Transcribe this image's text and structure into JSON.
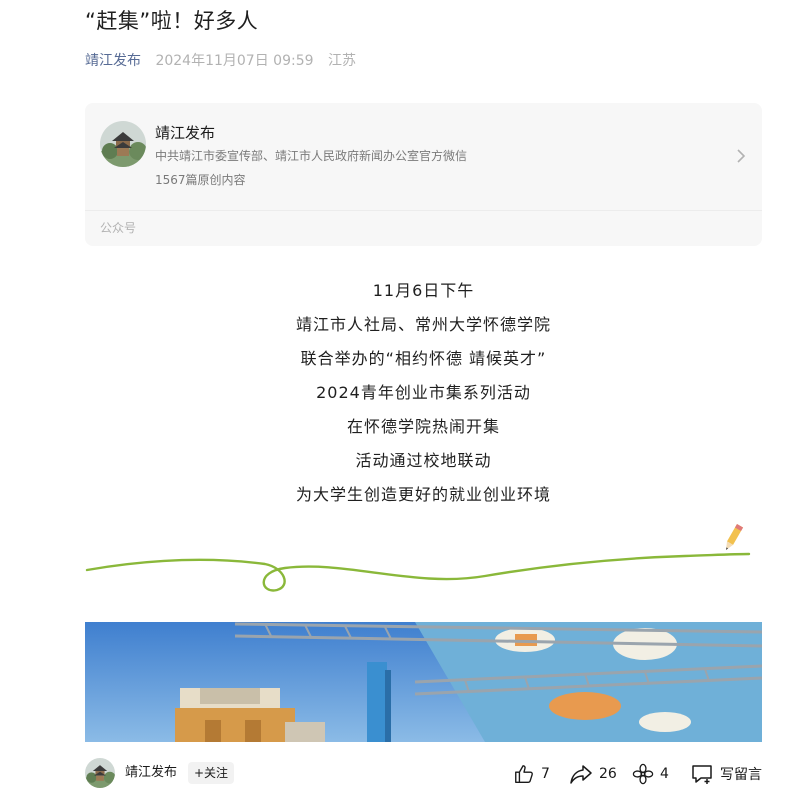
{
  "article": {
    "title": "“赶集”啦！好多人",
    "author": "靖江发布",
    "publish_time": "2024年11月07日 09:59",
    "location": "江苏"
  },
  "account_card": {
    "name": "靖江发布",
    "description": "中共靖江市委宣传部、靖江市人民政府新闻办公室官方微信",
    "original_count": "1567篇原创内容",
    "type_label": "公众号"
  },
  "body_lines": [
    "11月6日下午",
    "靖江市人社局、常州大学怀德学院",
    "联合举办的“相约怀德 靖候英才”",
    "2024青年创业市集系列活动",
    "在怀德学院热闹开集",
    "活动通过校地联动",
    "为大学生创造更好的就业创业环境"
  ],
  "bottom_bar": {
    "account_name": "靖江发布",
    "follow_label": "+关注",
    "like_count": "7",
    "share_count": "26",
    "wow_count": "4",
    "comment_label": "写留言"
  },
  "icons": {
    "like": "thumbs-up-icon",
    "share": "share-arrow-icon",
    "wow": "flower-icon",
    "comment": "comment-box-icon",
    "card_arrow": "chevron-right-icon",
    "pencil": "pencil-icon"
  },
  "colors": {
    "author_link": "#576b95",
    "meta_gray": "#b2b2b2",
    "card_bg": "#f7f7f7",
    "wave_green": "#8ab83a"
  }
}
